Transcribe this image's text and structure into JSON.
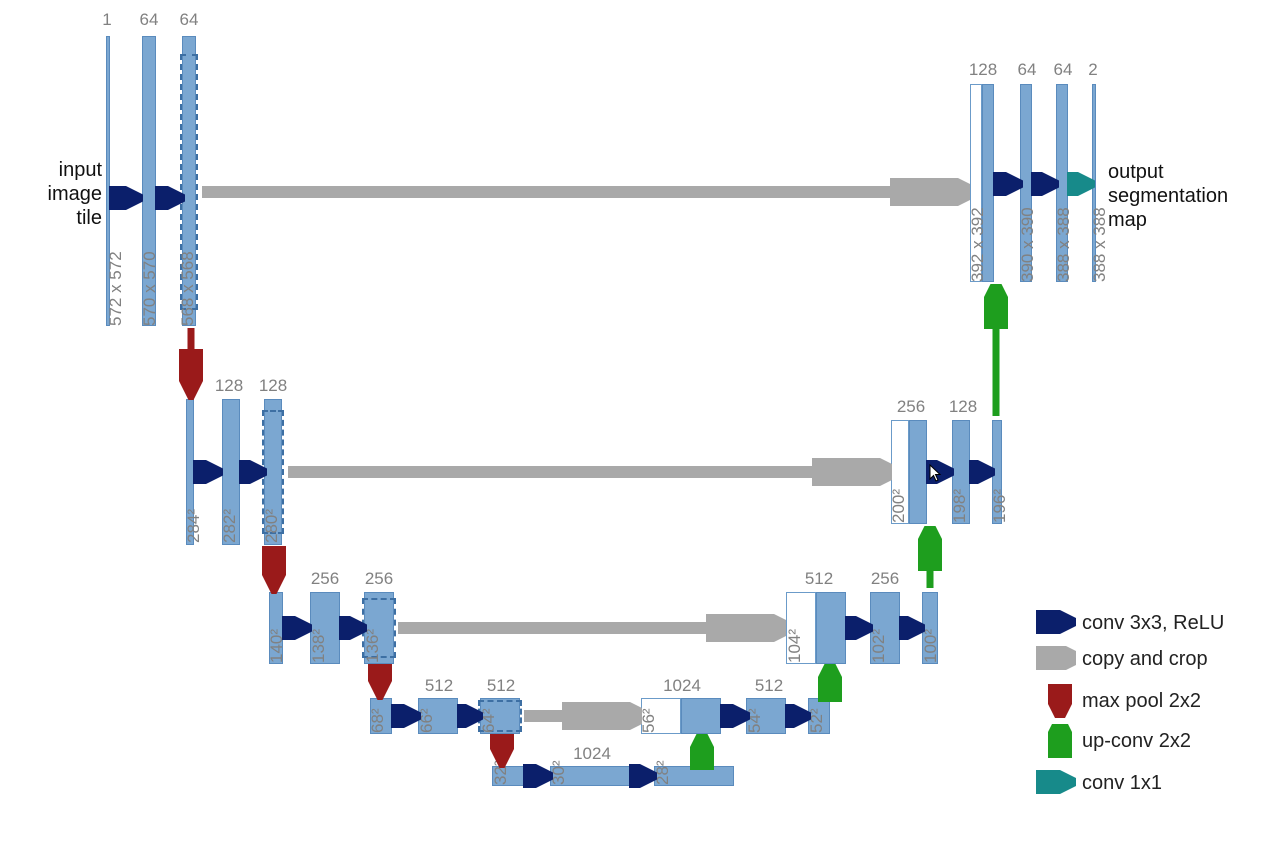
{
  "labels": {
    "input": "input\nimage\ntile",
    "output": "output\nsegmentation\nmap"
  },
  "legend": {
    "conv": "conv 3x3, ReLU",
    "copy": "copy and crop",
    "pool": "max pool 2x2",
    "upconv": "up-conv 2x2",
    "conv1": "conv 1x1"
  },
  "channels": {
    "l0": [
      "1",
      "64",
      "64"
    ],
    "l1": [
      "128",
      "128"
    ],
    "l2": [
      "256",
      "256"
    ],
    "l3": [
      "512",
      "512"
    ],
    "l4": [
      "1024"
    ],
    "r4": [
      "1024",
      "512"
    ],
    "r3": [
      "512",
      "256"
    ],
    "r2": [
      "256",
      "128"
    ],
    "r1": [
      "128",
      "64",
      "64",
      "2"
    ]
  },
  "sizes": {
    "l0": [
      "572 x 572",
      "570 x 570",
      "568 x 568"
    ],
    "l1": [
      "284²",
      "282²",
      "280²"
    ],
    "l2": [
      "140²",
      "138²",
      "136²"
    ],
    "l3": [
      "68²",
      "66²",
      "64²"
    ],
    "l4": [
      "32²",
      "30²",
      "28²"
    ],
    "r4": [
      "56²",
      "54²",
      "52²"
    ],
    "r3": [
      "104²",
      "102²",
      "100²"
    ],
    "r2": [
      "200²",
      "198²",
      "196²"
    ],
    "r1": [
      "392 x 392",
      "390 x 390",
      "388 x 388",
      "388 x 388"
    ]
  }
}
